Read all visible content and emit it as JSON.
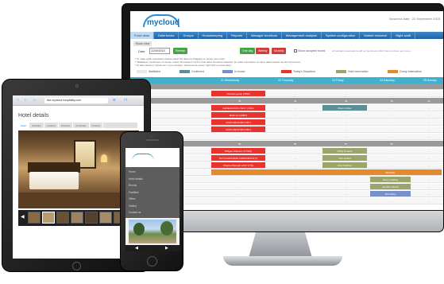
{
  "monitor": {
    "logo_text": "mycloud",
    "business_date": "Business date : 22 September 2015",
    "nav": [
      "Front desk",
      "Deferbooks",
      "Groups",
      "Housekeeping",
      "Reports",
      "Manager functions",
      "Management analysis",
      "System configuration",
      "Market research",
      "Night audit"
    ],
    "sub_title": "Room view",
    "date_label": "Date",
    "date_value": "22/09/2015",
    "buttons": {
      "refresh": "Refresh",
      "one_day": "One day",
      "weekly": "Weekly",
      "monthly": "Monthly"
    },
    "show_occupied": "Show occupied rooms",
    "side_note": "All standard reservations will not be shown which have not been any room...",
    "notes": [
      "* To make quick reservation please select the dates by dragging on empty room cells.",
      "* 'Waitlisted / Confirmed / In-house / Hold / Permanent' not for multi dates should be selected. (to make reservation on same dates please use the full screen)",
      "* To add 'check-in / check-out / room transfer / hold amount preset' right click on reservation"
    ],
    "legend": [
      {
        "label": "Waitlisted",
        "color": "#e8e8e8"
      },
      {
        "label": "Confirmed",
        "color": "#5a8f95"
      },
      {
        "label": "In-house",
        "color": "#7790c8"
      },
      {
        "label": "Today's Departure",
        "color": "#e8332e"
      },
      {
        "label": "Hold reservation",
        "color": "#9aa56b"
      },
      {
        "label": "Group reservation",
        "color": "#e58a2a"
      }
    ],
    "day_headers": [
      "21 Wednesday",
      "22 Thursday",
      "23 Friday",
      "24 Saturday",
      "25 Sunday"
    ],
    "rows": [
      {
        "label": "DLUP",
        "group": true,
        "nums": [
          "",
          "",
          "",
          "",
          ""
        ]
      },
      {
        "label": "",
        "group": false,
        "nums": [
          "",
          "",
          "",
          "",
          ""
        ]
      },
      {
        "label": "DX",
        "group": true,
        "nums": [
          "45",
          "46",
          "46",
          "46",
          "42"
        ]
      },
      {
        "label": "",
        "group": false,
        "nums": [
          "",
          "",
          "",
          "",
          ""
        ]
      },
      {
        "label": "",
        "group": false,
        "nums": [
          "",
          "",
          "",
          "",
          ""
        ]
      },
      {
        "label": "",
        "group": false,
        "nums": [
          "",
          "",
          "",
          "",
          ""
        ]
      },
      {
        "label": "",
        "group": false,
        "nums": [
          "",
          "",
          "",
          "",
          ""
        ]
      },
      {
        "label": "",
        "group": false,
        "nums": [
          "",
          "",
          "",
          "",
          ""
        ]
      },
      {
        "label": "",
        "group": true,
        "nums": [
          "86",
          "86",
          "87",
          "86",
          ""
        ]
      },
      {
        "label": "",
        "group": false,
        "nums": [
          "",
          "",
          "",
          "",
          ""
        ]
      },
      {
        "label": "",
        "group": false,
        "nums": [
          "",
          "",
          "",
          "",
          ""
        ]
      },
      {
        "label": "",
        "group": false,
        "nums": [
          "",
          "",
          "",
          "",
          ""
        ]
      },
      {
        "label": "",
        "group": false,
        "nums": [
          "",
          "",
          "",
          "",
          ""
        ]
      },
      {
        "label": "",
        "group": false,
        "nums": [
          "",
          "",
          "",
          "",
          ""
        ]
      },
      {
        "label": "",
        "group": false,
        "nums": [
          "",
          "",
          "",
          "",
          ""
        ]
      },
      {
        "label": "",
        "group": false,
        "nums": [
          "",
          "",
          "",
          "",
          ""
        ]
      },
      {
        "label": "",
        "group": false,
        "nums": [
          "",
          "",
          "",
          "",
          ""
        ]
      }
    ],
    "bookings": [
      {
        "text": "Hinnoan group (7893)",
        "color": "red",
        "row": 1,
        "col": 0
      },
      {
        "text": "RESERVATION TEST (7400)",
        "color": "red",
        "row": 3,
        "col": 0
      },
      {
        "text": "Bush Jon (2987)",
        "color": "red",
        "row": 4,
        "col": 0
      },
      {
        "text": "JOHN HENA NB (7367)",
        "color": "red",
        "row": 5,
        "col": 0
      },
      {
        "text": "JOHN HENA NB (7367)",
        "color": "red",
        "row": 6,
        "col": 0
      },
      {
        "text": "Moon Umber",
        "color": "teal",
        "row": 3,
        "col": 2
      },
      {
        "text": "Widgeo Shavera II (7333)",
        "color": "red",
        "row": 9,
        "col": 0
      },
      {
        "text": "DIVI DAMONSON CORPORATE (7)",
        "color": "red",
        "row": 10,
        "col": 0
      },
      {
        "text": "Shawna Renault LAST (770)",
        "color": "red",
        "row": 11,
        "col": 0
      },
      {
        "text": "Fathy Ismaele",
        "color": "olive",
        "row": 9,
        "col": 2
      },
      {
        "text": "Irish Ireland",
        "color": "olive",
        "row": 10,
        "col": 2
      },
      {
        "text": "Rost Sullivan",
        "color": "olive",
        "row": 11,
        "col": 2
      },
      {
        "text": "",
        "color": "orange",
        "row": 12,
        "col": 0,
        "span": 5
      },
      {
        "text": "Bill (697)",
        "color": "orange",
        "row": 12,
        "col": 3
      },
      {
        "text": "Nancy Darling",
        "color": "olive",
        "row": 13,
        "col": 3
      },
      {
        "text": "Jennifer Patrick",
        "color": "olive",
        "row": 14,
        "col": 3
      },
      {
        "text": "Mia Sibley",
        "color": "blue",
        "row": 15,
        "col": 3
      }
    ]
  },
  "tablet": {
    "url": "live.mycloud.hospitality.com",
    "page_title": "Hotel details",
    "tabs": [
      "Hotel",
      "Facilities",
      "Location",
      "Reviews",
      "Amenities",
      "Policies"
    ]
  },
  "phone": {
    "menu": [
      "Home",
      "Hotel details",
      "Rooms",
      "Facilities",
      "Offers",
      "Gallery",
      "Contact us"
    ]
  }
}
